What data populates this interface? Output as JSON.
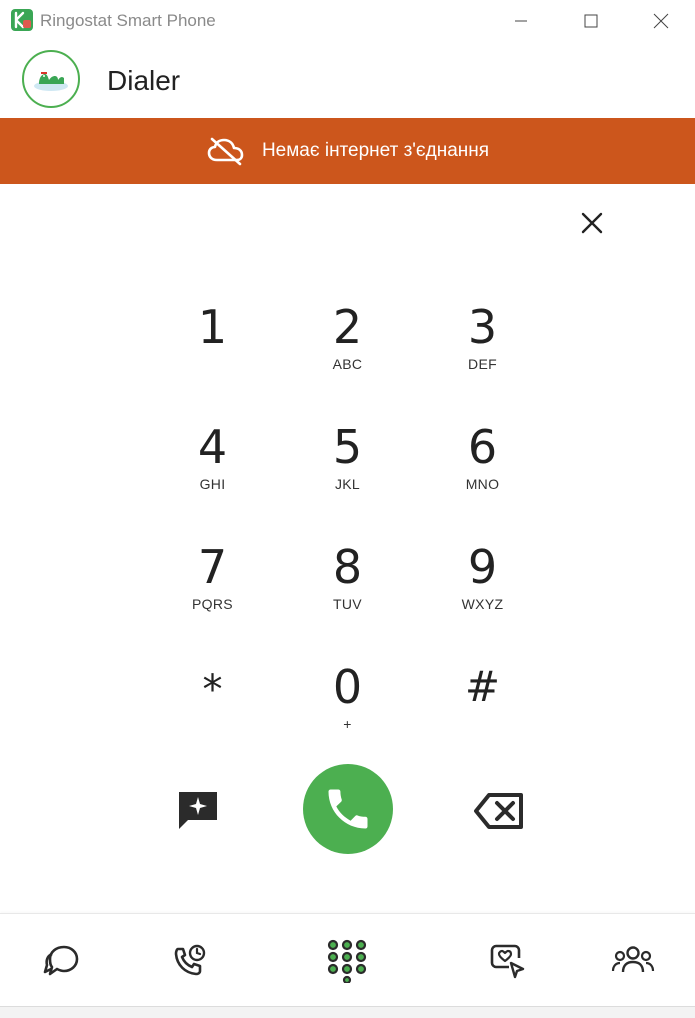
{
  "window": {
    "title": "Ringostat Smart Phone"
  },
  "header": {
    "title": "Dialer"
  },
  "banner": {
    "text": "Немає інтернет з'єднання"
  },
  "keypad": {
    "keys": [
      {
        "digit": "1",
        "letters": ""
      },
      {
        "digit": "2",
        "letters": "ABC"
      },
      {
        "digit": "3",
        "letters": "DEF"
      },
      {
        "digit": "4",
        "letters": "GHI"
      },
      {
        "digit": "5",
        "letters": "JKL"
      },
      {
        "digit": "6",
        "letters": "MNO"
      },
      {
        "digit": "7",
        "letters": "PQRS"
      },
      {
        "digit": "8",
        "letters": "TUV"
      },
      {
        "digit": "9",
        "letters": "WXYZ"
      },
      {
        "digit": "*",
        "letters": ""
      },
      {
        "digit": "0",
        "letters": "+"
      },
      {
        "digit": "#",
        "letters": ""
      }
    ]
  },
  "nav": {
    "items": [
      {
        "icon": "chat-icon"
      },
      {
        "icon": "call-history-icon"
      },
      {
        "icon": "dialpad-icon",
        "active": true
      },
      {
        "icon": "heart-cursor-icon"
      },
      {
        "icon": "contacts-icon"
      }
    ]
  },
  "colors": {
    "banner": "#cc561c",
    "accent_green": "#4caf50",
    "text": "#222222"
  }
}
